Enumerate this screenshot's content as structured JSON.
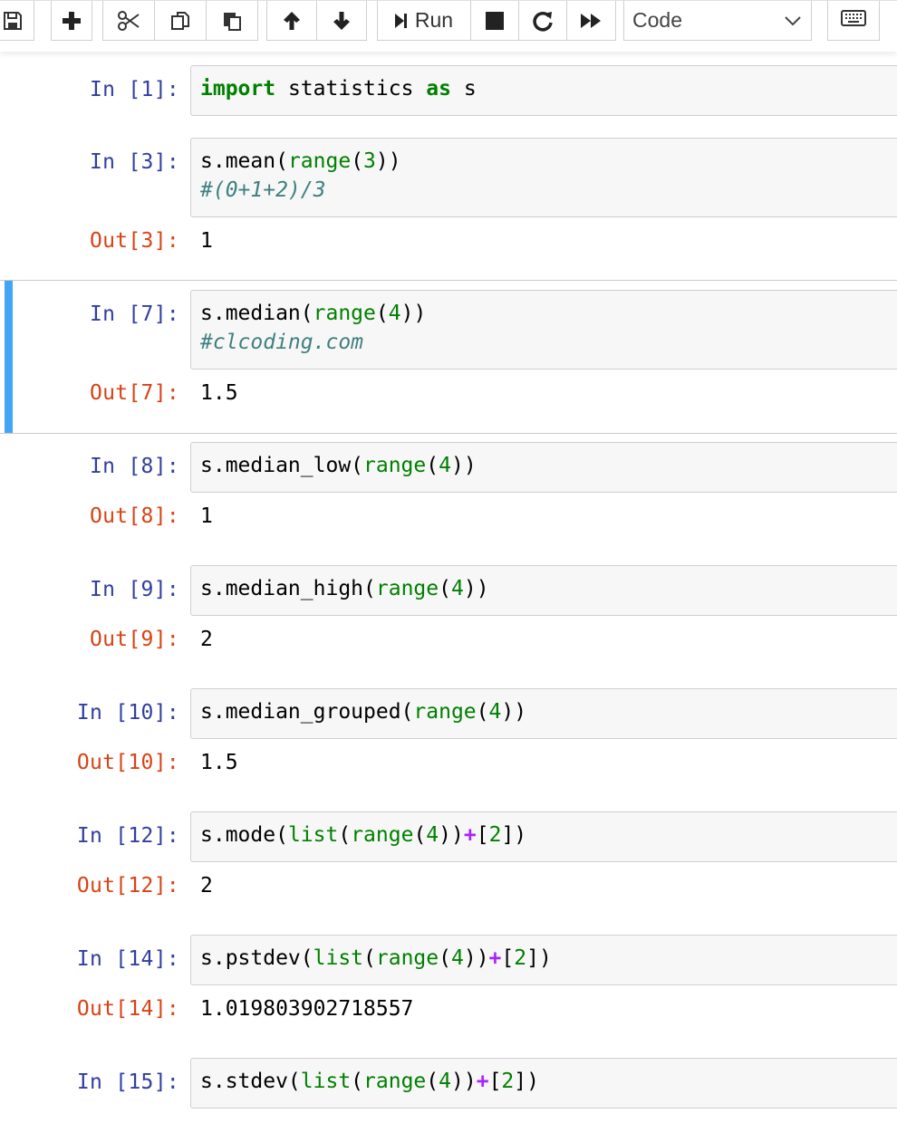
{
  "toolbar": {
    "run_label": "Run",
    "cell_type": "Code",
    "buttons": [
      "save-icon",
      "plus-icon",
      "cut-icon",
      "copy-icon",
      "paste-icon",
      "arrow-up-icon",
      "arrow-down-icon",
      "run-icon",
      "stop-icon",
      "restart-icon",
      "fast-forward-icon",
      "keyboard-icon"
    ]
  },
  "cells": [
    {
      "in_prompt": "In [1]:",
      "code": [
        [
          [
            "kw",
            "import"
          ],
          [
            "t",
            " statistics "
          ],
          [
            "kw",
            "as"
          ],
          [
            "t",
            " s"
          ]
        ]
      ],
      "out_prompt": "",
      "output": ""
    },
    {
      "in_prompt": "In [3]:",
      "code": [
        [
          [
            "t",
            "s.mean("
          ],
          [
            "bi",
            "range"
          ],
          [
            "t",
            "("
          ],
          [
            "num",
            "3"
          ],
          [
            "t",
            "))"
          ]
        ],
        [
          [
            "cm",
            "#(0+1+2)/3"
          ]
        ]
      ],
      "out_prompt": "Out[3]:",
      "output": "1"
    },
    {
      "in_prompt": "In [7]:",
      "code": [
        [
          [
            "t",
            "s.median("
          ],
          [
            "bi",
            "range"
          ],
          [
            "t",
            "("
          ],
          [
            "num",
            "4"
          ],
          [
            "t",
            "))"
          ]
        ],
        [
          [
            "cm",
            "#clcoding.com"
          ]
        ]
      ],
      "out_prompt": "Out[7]:",
      "output": "1.5",
      "selected": true
    },
    {
      "in_prompt": "In [8]:",
      "code": [
        [
          [
            "t",
            "s.median_low("
          ],
          [
            "bi",
            "range"
          ],
          [
            "t",
            "("
          ],
          [
            "num",
            "4"
          ],
          [
            "t",
            "))"
          ]
        ]
      ],
      "out_prompt": "Out[8]:",
      "output": "1"
    },
    {
      "in_prompt": "In [9]:",
      "code": [
        [
          [
            "t",
            "s.median_high("
          ],
          [
            "bi",
            "range"
          ],
          [
            "t",
            "("
          ],
          [
            "num",
            "4"
          ],
          [
            "t",
            "))"
          ]
        ]
      ],
      "out_prompt": "Out[9]:",
      "output": "2"
    },
    {
      "in_prompt": "In [10]:",
      "code": [
        [
          [
            "t",
            "s.median_grouped("
          ],
          [
            "bi",
            "range"
          ],
          [
            "t",
            "("
          ],
          [
            "num",
            "4"
          ],
          [
            "t",
            "))"
          ]
        ]
      ],
      "out_prompt": "Out[10]:",
      "output": "1.5"
    },
    {
      "in_prompt": "In [12]:",
      "code": [
        [
          [
            "t",
            "s.mode("
          ],
          [
            "bi",
            "list"
          ],
          [
            "t",
            "("
          ],
          [
            "bi",
            "range"
          ],
          [
            "t",
            "("
          ],
          [
            "num",
            "4"
          ],
          [
            "t",
            "))"
          ],
          [
            "op",
            "+"
          ],
          [
            "t",
            "["
          ],
          [
            "num",
            "2"
          ],
          [
            "t",
            "])"
          ]
        ]
      ],
      "out_prompt": "Out[12]:",
      "output": "2"
    },
    {
      "in_prompt": "In [14]:",
      "code": [
        [
          [
            "t",
            "s.pstdev("
          ],
          [
            "bi",
            "list"
          ],
          [
            "t",
            "("
          ],
          [
            "bi",
            "range"
          ],
          [
            "t",
            "("
          ],
          [
            "num",
            "4"
          ],
          [
            "t",
            "))"
          ],
          [
            "op",
            "+"
          ],
          [
            "t",
            "["
          ],
          [
            "num",
            "2"
          ],
          [
            "t",
            "])"
          ]
        ]
      ],
      "out_prompt": "Out[14]:",
      "output": "1.019803902718557"
    },
    {
      "in_prompt": "In [15]:",
      "code": [
        [
          [
            "t",
            "s.stdev("
          ],
          [
            "bi",
            "list"
          ],
          [
            "t",
            "("
          ],
          [
            "bi",
            "range"
          ],
          [
            "t",
            "("
          ],
          [
            "num",
            "4"
          ],
          [
            "t",
            "))"
          ],
          [
            "op",
            "+"
          ],
          [
            "t",
            "["
          ],
          [
            "num",
            "2"
          ],
          [
            "t",
            "])"
          ]
        ]
      ],
      "out_prompt": "",
      "output": ""
    }
  ]
}
